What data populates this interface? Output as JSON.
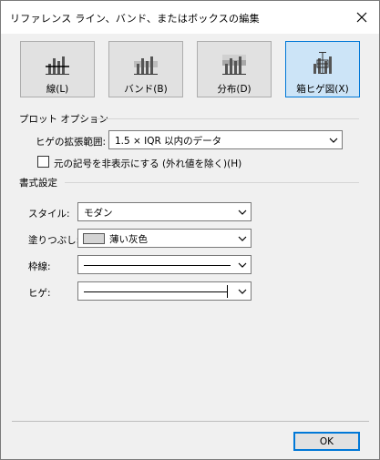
{
  "window": {
    "title": "リファレンス ライン、バンド、またはボックスの編集",
    "close_icon": "close-icon"
  },
  "modes": [
    {
      "label": "線(L)",
      "icon": "line-chart-icon",
      "selected": false
    },
    {
      "label": "バンド(B)",
      "icon": "band-chart-icon",
      "selected": false
    },
    {
      "label": "分布(D)",
      "icon": "distribution-chart-icon",
      "selected": false
    },
    {
      "label": "箱ヒゲ図(X)",
      "icon": "box-plot-icon",
      "selected": true
    }
  ],
  "plot_options": {
    "section_title": "プロット オプション",
    "whisker_label": "ヒゲの拡張範囲:",
    "whisker_value": "1.5 × IQR 以内のデータ",
    "hide_marks_label": "元の記号を非表示にする (外れ値を除く)(H)",
    "hide_marks_checked": false
  },
  "formatting": {
    "section_title": "書式設定",
    "style_label": "スタイル:",
    "style_value": "モダン",
    "fill_label": "塗りつぶし:",
    "fill_value": "薄い灰色",
    "fill_color": "#d4d4d4",
    "border_label": "枠線:",
    "whisker_label": "ヒゲ:"
  },
  "footer": {
    "ok_label": "OK"
  },
  "colors": {
    "accent": "#0078d7",
    "selected_bg": "#cce4f7",
    "dialog_bg": "#f0f0f0"
  }
}
